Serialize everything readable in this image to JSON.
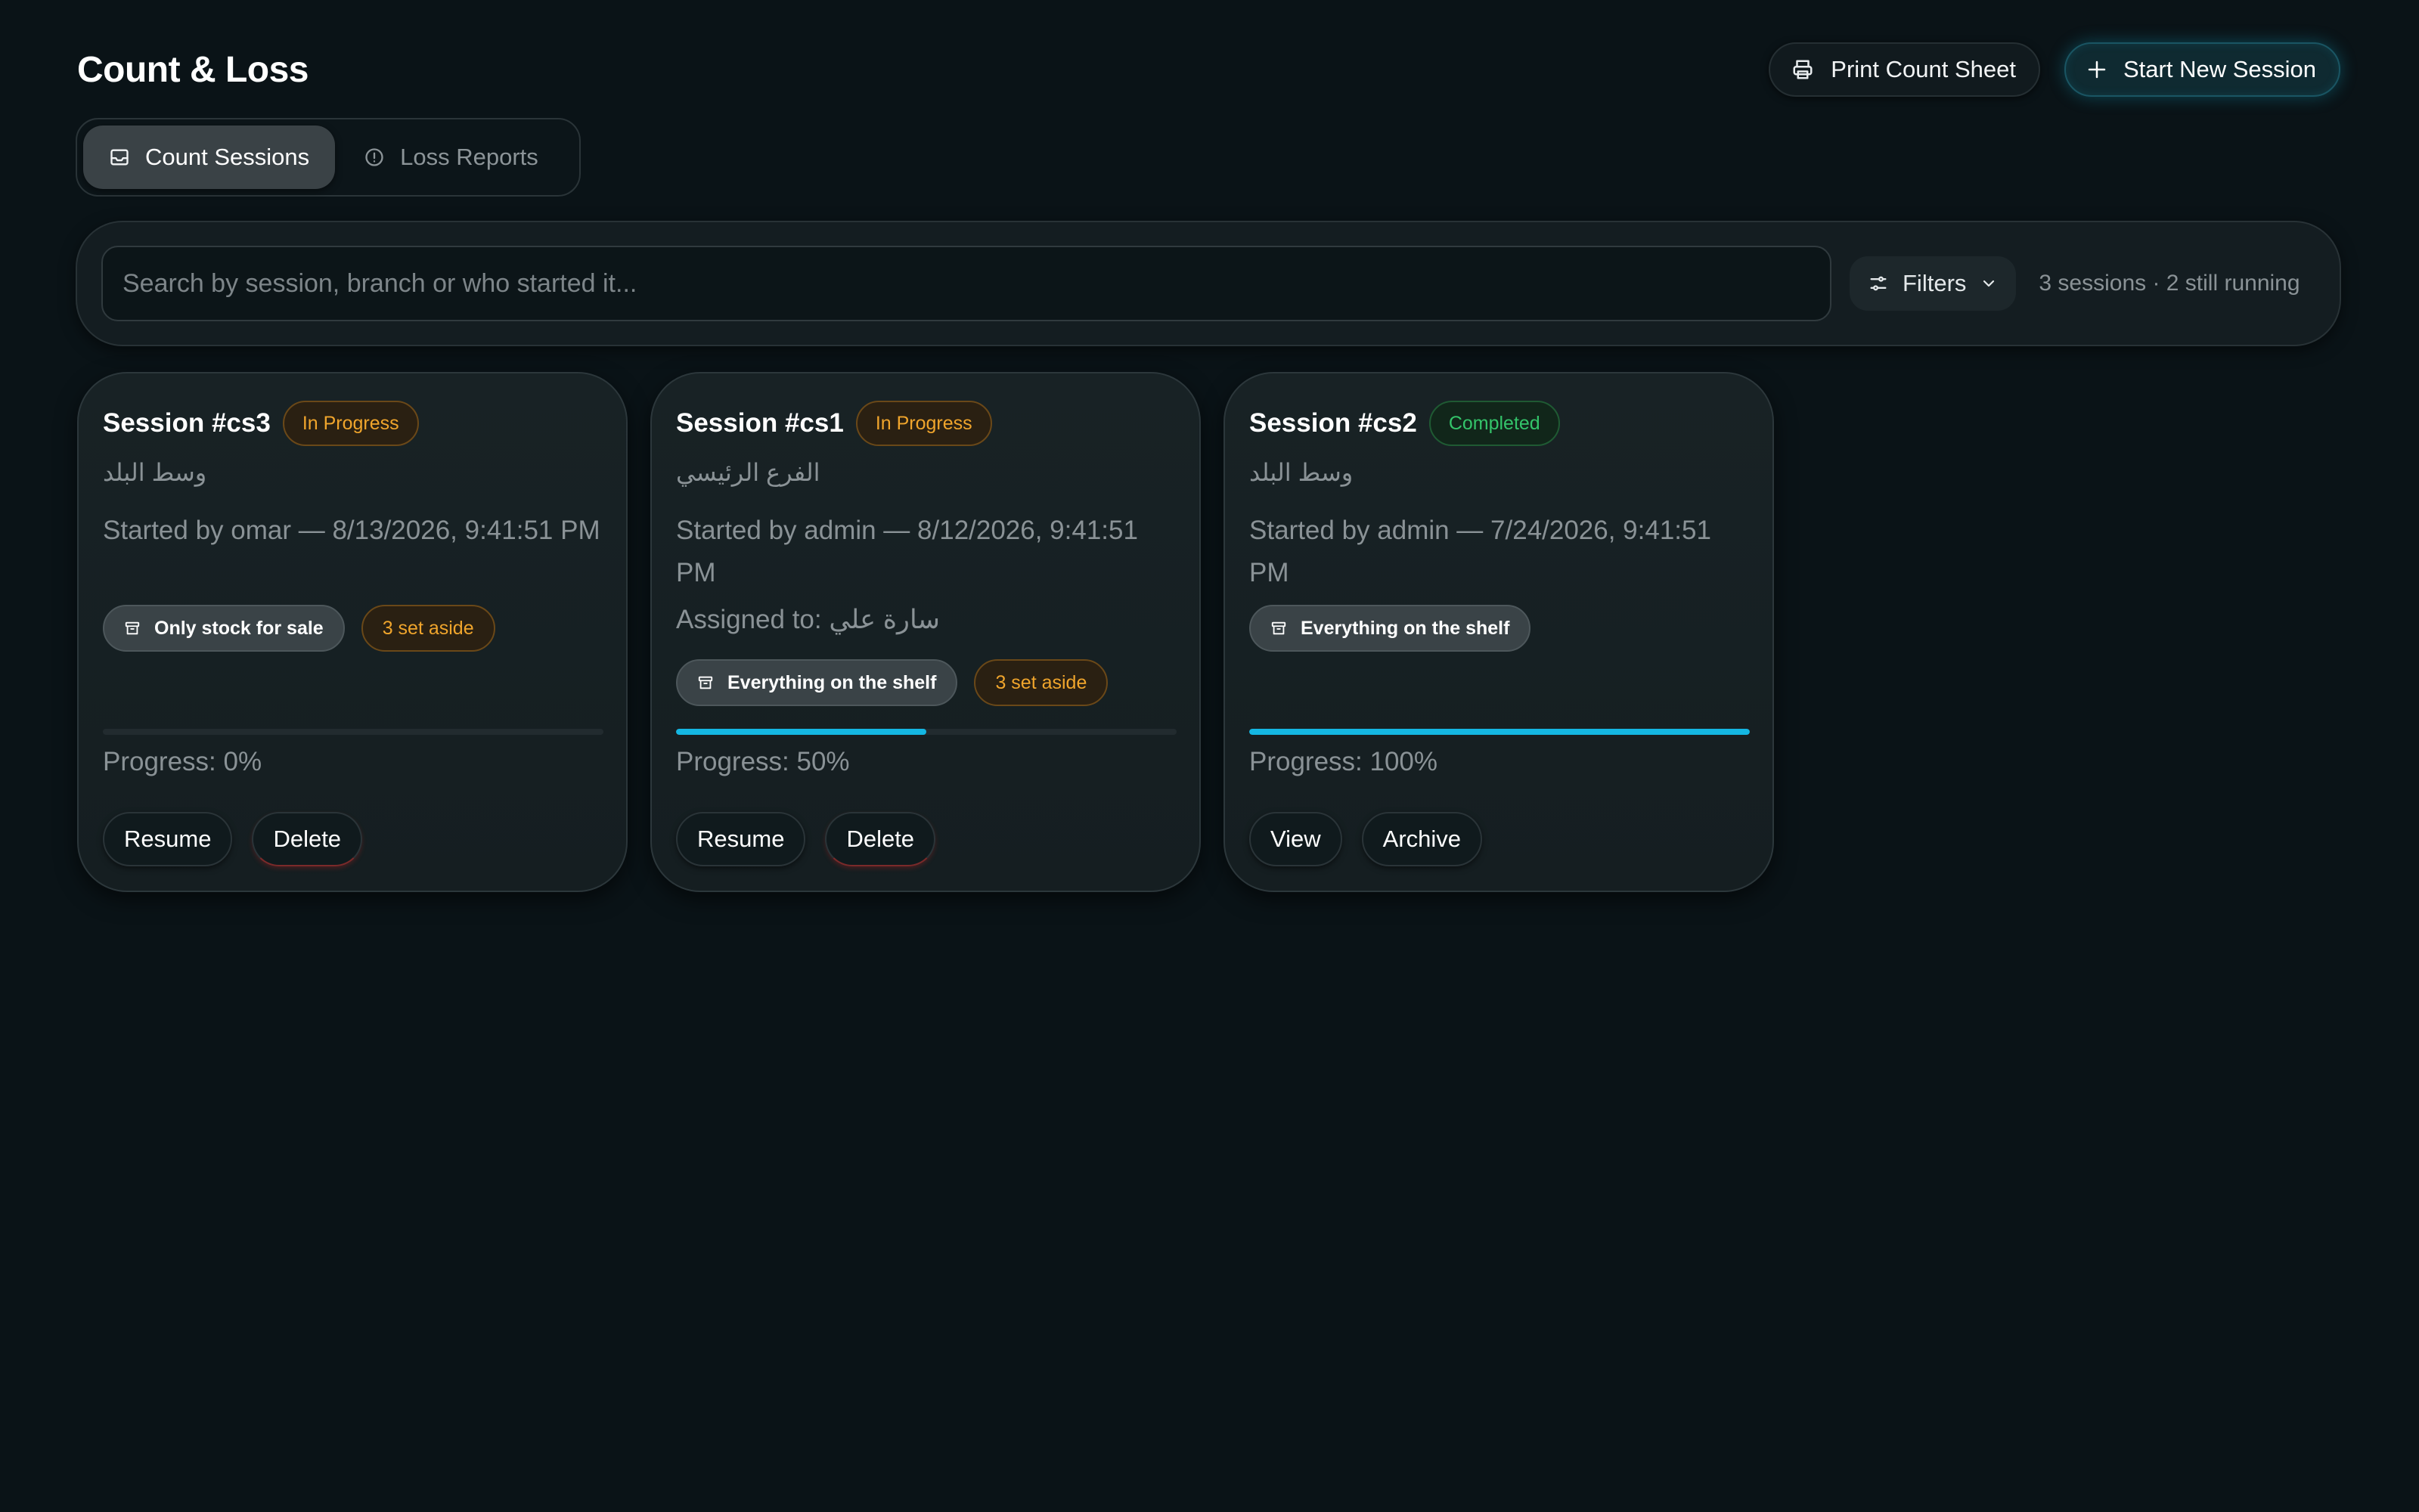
{
  "header": {
    "title": "Count & Loss",
    "print_label": "Print Count Sheet",
    "start_label": "Start New Session"
  },
  "tabs": [
    {
      "label": "Count Sessions",
      "icon": "inbox-icon",
      "active": true
    },
    {
      "label": "Loss Reports",
      "icon": "alert-circle-icon",
      "active": false
    }
  ],
  "search": {
    "placeholder": "Search by session, branch or who started it...",
    "value": "",
    "filters_label": "Filters",
    "summary": "3 sessions · 2 still running"
  },
  "sessions": [
    {
      "title": "Session #cs3",
      "status": "In Progress",
      "branch": "وسط البلد",
      "started": "Started by omar — 8/13/2026, 9:41:51 PM",
      "assigned": "",
      "scope": "Only stock for sale",
      "set_aside": "3 set aside",
      "progress": 0,
      "progress_text": "Progress: 0%",
      "action1": "Resume",
      "action2": "Delete"
    },
    {
      "title": "Session #cs1",
      "status": "In Progress",
      "branch": "الفرع الرئيسي",
      "started": "Started by admin — 8/12/2026, 9:41:51 PM",
      "assigned": "Assigned to: سارة علي",
      "scope": "Everything on the shelf",
      "set_aside": "3 set aside",
      "progress": 50,
      "progress_text": "Progress: 50%",
      "action1": "Resume",
      "action2": "Delete"
    },
    {
      "title": "Session #cs2",
      "status": "Completed",
      "branch": "وسط البلد",
      "started": "Started by admin — 7/24/2026, 9:41:51 PM",
      "assigned": "",
      "scope": "Everything on the shelf",
      "set_aside": "",
      "progress": 100,
      "progress_text": "Progress: 100%",
      "action1": "View",
      "action2": "Archive"
    }
  ],
  "colors": {
    "background": "#0a1317",
    "accent": "#14b7e3",
    "in_progress": "#f0a52c",
    "completed": "#34c46a"
  }
}
